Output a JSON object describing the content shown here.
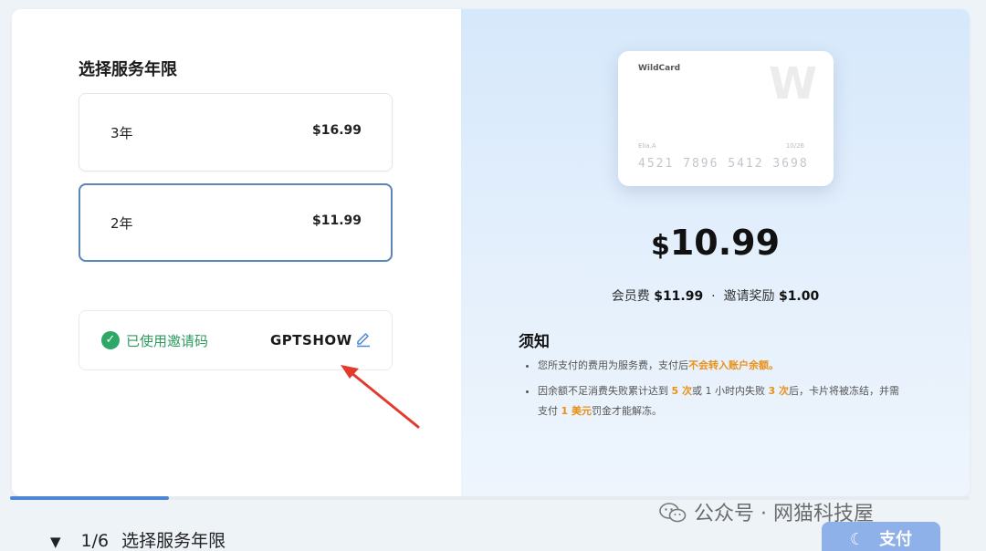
{
  "plan_section": {
    "title": "选择服务年限",
    "plans": [
      {
        "name": "3年",
        "price": "$16.99"
      },
      {
        "name": "2年",
        "price": "$11.99"
      }
    ]
  },
  "invite": {
    "status_text": "已使用邀请码",
    "code": "GPTSHOW"
  },
  "card_preview": {
    "brand": "WildCard",
    "logo": "W",
    "holder": "Elia.A",
    "expiry": "10/26",
    "number": "4521  7896  5412  3698"
  },
  "summary": {
    "currency": "$",
    "amount": "10.99",
    "fee_label": "会员费",
    "fee_value": "$11.99",
    "separator": "·",
    "reward_label": "邀请奖励",
    "reward_value": "$1.00"
  },
  "notice": {
    "title": "须知",
    "item1_pre": "您所支付的费用为服务费，支付后",
    "item1_hl": "不会转入账户余额。",
    "item2_a": "因余额不足消费失败累计达到 ",
    "item2_b": "5 次",
    "item2_c": "或 1 小时内失败 ",
    "item2_d": "3 次",
    "item2_e": "后，卡片将被冻结，并需支付 ",
    "item2_f": "1 美元",
    "item2_g": "罚金才能解冻。"
  },
  "progress": {
    "value": 0.166
  },
  "footer": {
    "step_number": "1/6",
    "step_label": "选择服务年限",
    "pay_label": "支付"
  },
  "watermark": {
    "text": "公众号 · 网猫科技屋"
  },
  "colors": {
    "accent": "#4d86d6",
    "success": "#2ea866",
    "highlight": "#e8911a",
    "pay_button": "#8fb1ea"
  }
}
